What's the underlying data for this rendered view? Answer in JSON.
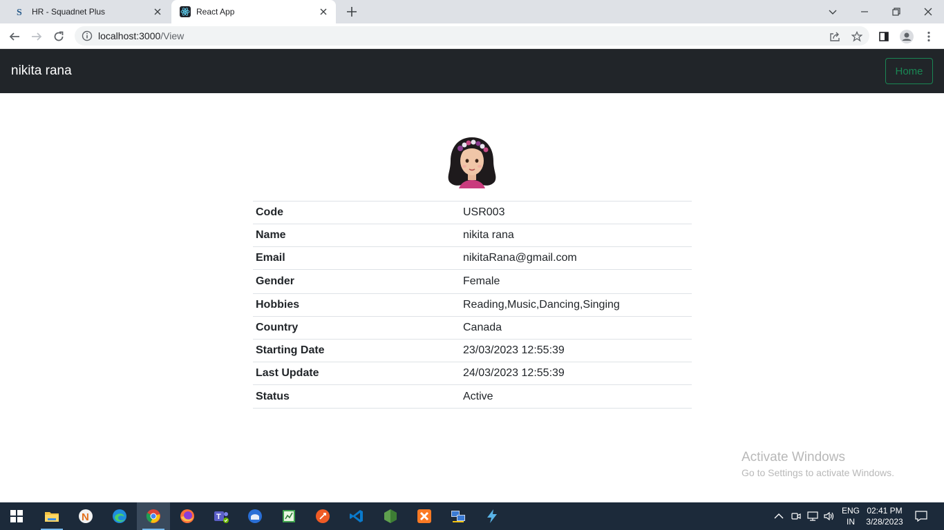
{
  "browser": {
    "tabs": [
      {
        "title": "HR - Squadnet Plus",
        "active": false
      },
      {
        "title": "React App",
        "active": true
      }
    ],
    "url_host": "localhost:3000",
    "url_path": "/View"
  },
  "navbar": {
    "brand": "nikita rana",
    "home_label": "Home"
  },
  "profile": {
    "rows": [
      {
        "label": "Code",
        "value": "USR003"
      },
      {
        "label": "Name",
        "value": "nikita rana"
      },
      {
        "label": "Email",
        "value": "nikitaRana@gmail.com"
      },
      {
        "label": "Gender",
        "value": "Female"
      },
      {
        "label": "Hobbies",
        "value": "Reading,Music,Dancing,Singing"
      },
      {
        "label": "Country",
        "value": "Canada"
      },
      {
        "label": "Starting Date",
        "value": "23/03/2023 12:55:39"
      },
      {
        "label": "Last Update",
        "value": "24/03/2023 12:55:39"
      },
      {
        "label": "Status",
        "value": "Active"
      }
    ]
  },
  "watermark": {
    "line1": "Activate Windows",
    "line2": "Go to Settings to activate Windows."
  },
  "taskbar": {
    "lang_line1": "ENG",
    "lang_line2": "IN",
    "time": "02:41 PM",
    "date": "3/28/2023"
  },
  "colors": {
    "navbar_bg": "#212529",
    "success": "#198754",
    "taskbar_bg": "#1c2a3a"
  }
}
